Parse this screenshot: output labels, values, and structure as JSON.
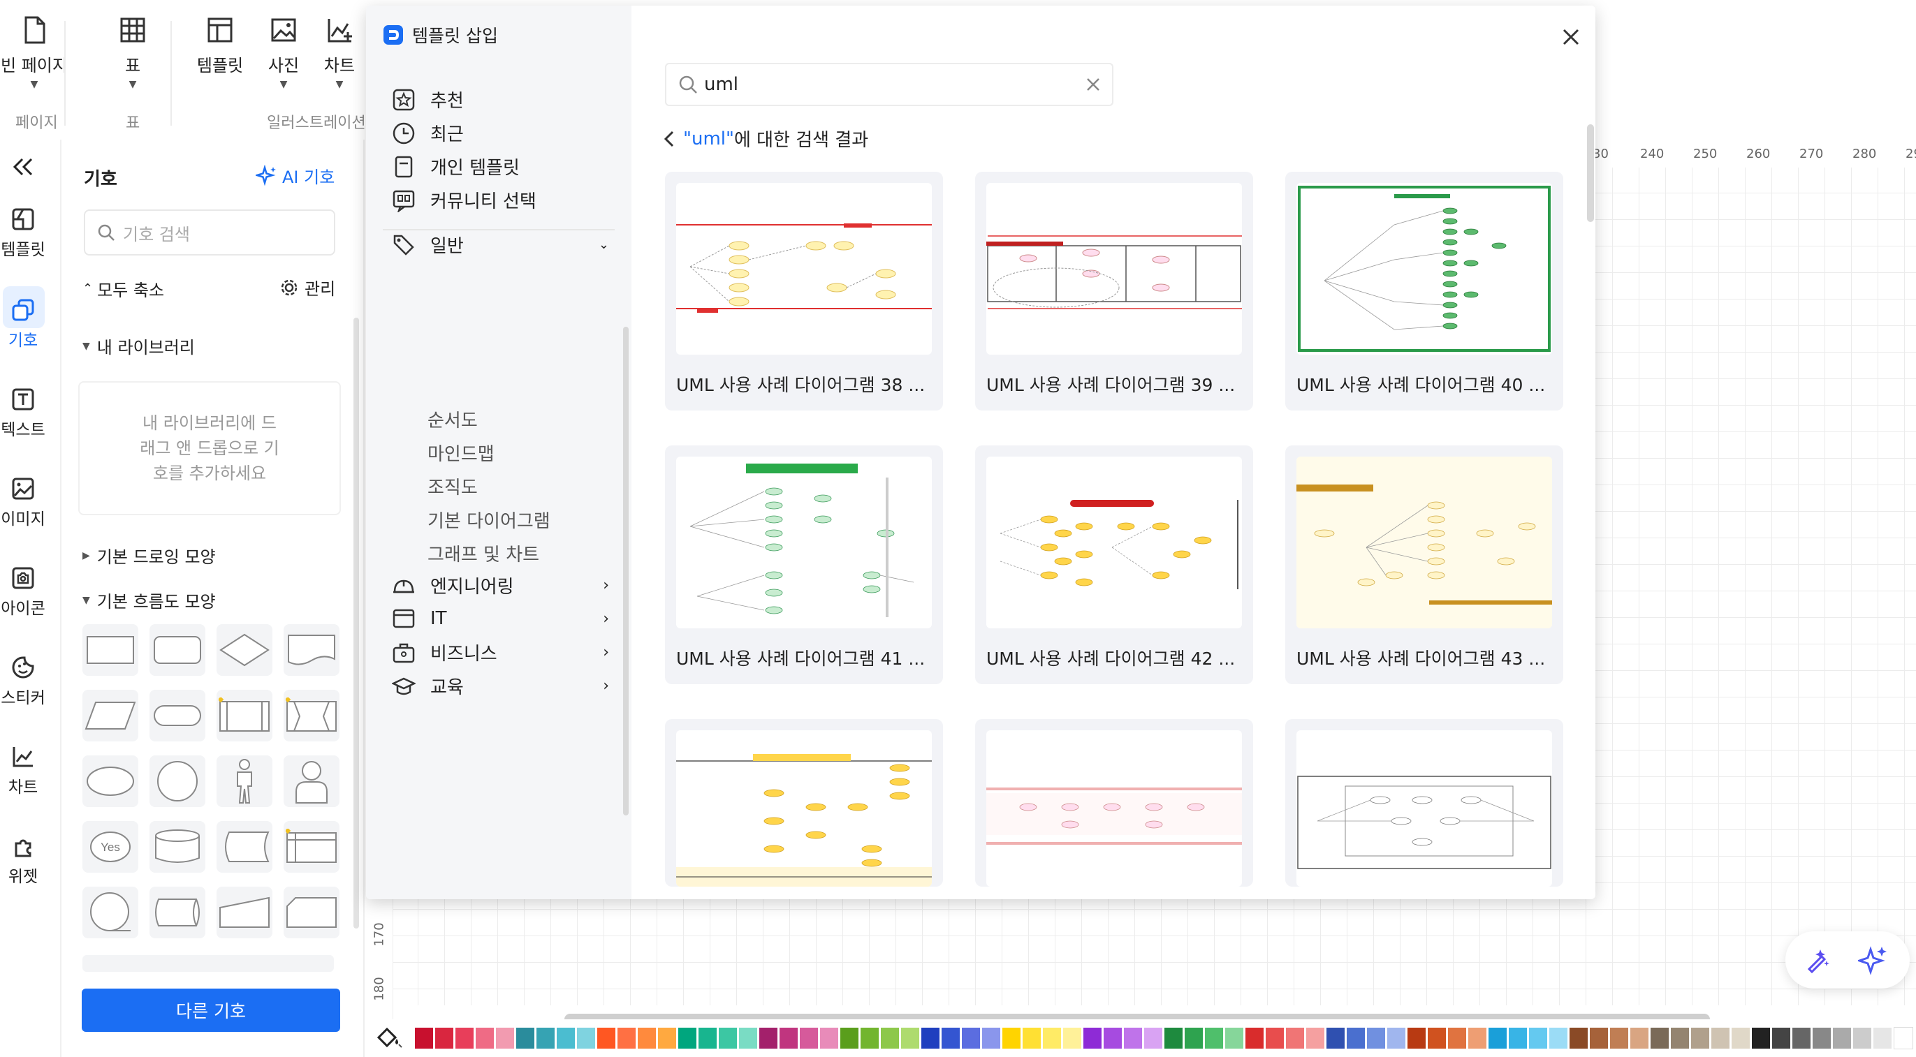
{
  "ribbon": {
    "page_label": "빈 페이지",
    "page_group": "페이지",
    "table_label": "표",
    "table_group": "표",
    "template_label": "템플릿",
    "photo_label": "사진",
    "chart_label": "차트",
    "illustration_group": "일러스트레이션"
  },
  "rail": {
    "collapse_icon": "double-chevron-left-icon",
    "items": [
      {
        "label": "템플릿",
        "icon": "template-icon"
      },
      {
        "label": "기호",
        "icon": "symbol-icon"
      },
      {
        "label": "텍스트",
        "icon": "text-icon"
      },
      {
        "label": "이미지",
        "icon": "image-icon"
      },
      {
        "label": "아이콘",
        "icon": "icon-icon"
      },
      {
        "label": "스티커",
        "icon": "sticker-icon"
      },
      {
        "label": "차트",
        "icon": "chart-icon"
      },
      {
        "label": "위젯",
        "icon": "widget-icon"
      }
    ]
  },
  "symbols": {
    "title": "기호",
    "ai_label": "AI 기호",
    "search_placeholder": "기호 검색",
    "collapse_all": "모두 축소",
    "manage": "관리",
    "my_library": "내 라이브러리",
    "library_hint": "내 라이브러리에 드래그 앤 드롭으로 기호를 추가하세요",
    "basic_drawing": "기본 드로잉 모양",
    "basic_flowchart": "기본 흐름도 모양",
    "yes_shape": "Yes",
    "more_button": "다른 기호"
  },
  "dialog": {
    "title": "템플릿 삽입",
    "search_value": "uml",
    "search_query": "\"uml\"",
    "result_suffix": "에 대한 검색 결과",
    "sidebar": {
      "recommended": "추천",
      "recent": "최근",
      "personal": "개인 템플릿",
      "community": "커뮤니티 선택",
      "general": "일반",
      "general_sub": [
        "순서도",
        "마인드맵",
        "조직도",
        "기본 다이어그램",
        "그래프 및 차트"
      ],
      "engineering": "엔지니어링",
      "it": "IT",
      "business": "비즈니스",
      "education": "교육"
    },
    "cards": [
      {
        "title": "UML 사용 사례 다이어그램 38 ..."
      },
      {
        "title": "UML 사용 사례 다이어그램 39 ..."
      },
      {
        "title": "UML 사용 사례 다이어그램 40 ..."
      },
      {
        "title": "UML 사용 사례 다이어그램 41 ..."
      },
      {
        "title": "UML 사용 사례 다이어그램 42 ..."
      },
      {
        "title": "UML 사용 사례 다이어그램 43 ..."
      }
    ]
  },
  "ruler": {
    "top_ticks": [
      "30",
      "240",
      "250",
      "260",
      "270",
      "280",
      "29"
    ],
    "left_ticks": [
      "170",
      "180"
    ]
  },
  "colors": [
    "#c8102e",
    "#d9263f",
    "#e83e5a",
    "#ef6b85",
    "#f29bb0",
    "#2a8c9c",
    "#36a3b3",
    "#4bbdd0",
    "#7fd3e0",
    "#ff5722",
    "#ff7043",
    "#ff8a3d",
    "#ffa940",
    "#00a67e",
    "#18b58f",
    "#3cc7a3",
    "#7adcc4",
    "#a3206b",
    "#c0357f",
    "#d65a9b",
    "#e88bb9",
    "#5a9e1c",
    "#72b52e",
    "#8dc84a",
    "#aedb6e",
    "#1f3fbf",
    "#3455d1",
    "#5b6de0",
    "#8a96ec",
    "#ffd400",
    "#ffe033",
    "#ffeb66",
    "#fff199",
    "#8e2bd6",
    "#a64be0",
    "#bf73ea",
    "#d9a3f3",
    "#1e8a3e",
    "#2ea34f",
    "#4fbf6b",
    "#86d69a",
    "#d92c2c",
    "#e84d4d",
    "#f07575",
    "#f5a0a0",
    "#2f50b0",
    "#4a6fcf",
    "#7090e0",
    "#a0b6ee",
    "#b83a12",
    "#d0521f",
    "#e07340",
    "#ee9e73",
    "#1a9fd9",
    "#38b4e6",
    "#64c9f0",
    "#9bdcf6",
    "#8a4a26",
    "#a6623a",
    "#c07e54",
    "#d9a582",
    "#7a6a58",
    "#948470",
    "#b0a08c",
    "#cfc3b2",
    "#e0d8c8",
    "#222222",
    "#444444",
    "#666666",
    "#888888",
    "#aaaaaa",
    "#cccccc",
    "#e6e6e6",
    "#ffffff"
  ]
}
